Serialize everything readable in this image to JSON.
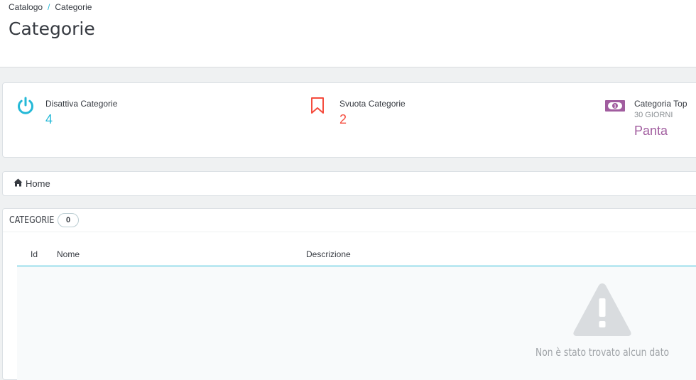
{
  "breadcrumb": {
    "parent": "Catalogo",
    "separator": "/",
    "current": "Categorie"
  },
  "page_title": "Categorie",
  "kpis": [
    {
      "title": "Disattiva Categorie",
      "value": "4",
      "icon": "power-icon",
      "color": "#25b9d7"
    },
    {
      "title": "Svuota Categorie",
      "value": "2",
      "icon": "bookmark-icon",
      "color": "#f54c3e"
    },
    {
      "title": "Categoria Top",
      "subtitle": "30 GIORNI",
      "value": "Panta",
      "icon": "money-icon",
      "color": "#a15d9f"
    }
  ],
  "category_breadcrumb": {
    "icon": "home-icon",
    "label": "Home"
  },
  "table": {
    "heading": "CATEGORIE",
    "count": "0",
    "columns": [
      "Id",
      "Nome",
      "Descrizione"
    ],
    "empty_icon": "warning-icon",
    "empty_message": "Non è stato trovato alcun dato"
  }
}
